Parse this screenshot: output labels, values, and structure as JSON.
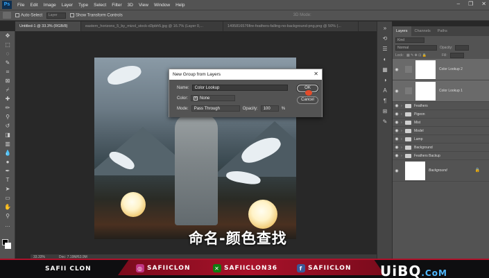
{
  "menubar": {
    "app_logo": "Ps",
    "items": [
      "File",
      "Edit",
      "Image",
      "Layer",
      "Type",
      "Select",
      "Filter",
      "3D",
      "View",
      "Window",
      "Help"
    ],
    "window_controls": [
      "–",
      "❐",
      "✕"
    ]
  },
  "options_bar": {
    "auto_select_label": "Auto-Select",
    "auto_select_value": "Layer",
    "show_transform_label": "Show Transform Controls",
    "mode_3d_label": "3D Mode:"
  },
  "document_tabs": [
    "Untitled-1 @ 33.3% (RGB/8)",
    "eastern_horizons_5_by_mizol_stock-d3pbh5.jpg @ 16.7% (Layer 0,...",
    "1495816576fire-feathers-falling-no-background-png.png @ 50% (..."
  ],
  "status": {
    "zoom": "33.33%",
    "doc_size": "Doc: 7.19M/63.9M"
  },
  "caption": "命名-颜色查找",
  "dialog": {
    "title": "New Group from Layers",
    "name_label": "Name:",
    "name_value": "Color Lookup",
    "color_label": "Color:",
    "color_value": "None",
    "mode_label": "Mode:",
    "mode_value": "Pass Through",
    "opacity_label": "Opacity:",
    "opacity_value": "100",
    "opacity_unit": "%",
    "ok_label": "OK",
    "cancel_label": "Cancel"
  },
  "layers_panel": {
    "tabs": [
      "Layers",
      "Channels",
      "Paths"
    ],
    "kind_label": "Kind",
    "blend_mode": "Normal",
    "opacity_label": "Opacity:",
    "lock_label": "Lock:",
    "fill_label": "Fill:",
    "adjustment_layers": [
      "Color Lookup 2",
      "Color Lookup 1"
    ],
    "groups": [
      "Feathers",
      "Pigeon",
      "Mist",
      "Model",
      "Lamp",
      "Background",
      "Feathers Backup"
    ],
    "background_layer": "Background"
  },
  "social_bar": {
    "channel_name": "SAFII CLON",
    "instagram": "SAFIICLON",
    "xbox": "SAFIICLON36",
    "facebook": "SAFIICLON",
    "watermark_main": "UiBQ",
    "watermark_sub": ".CoM"
  }
}
